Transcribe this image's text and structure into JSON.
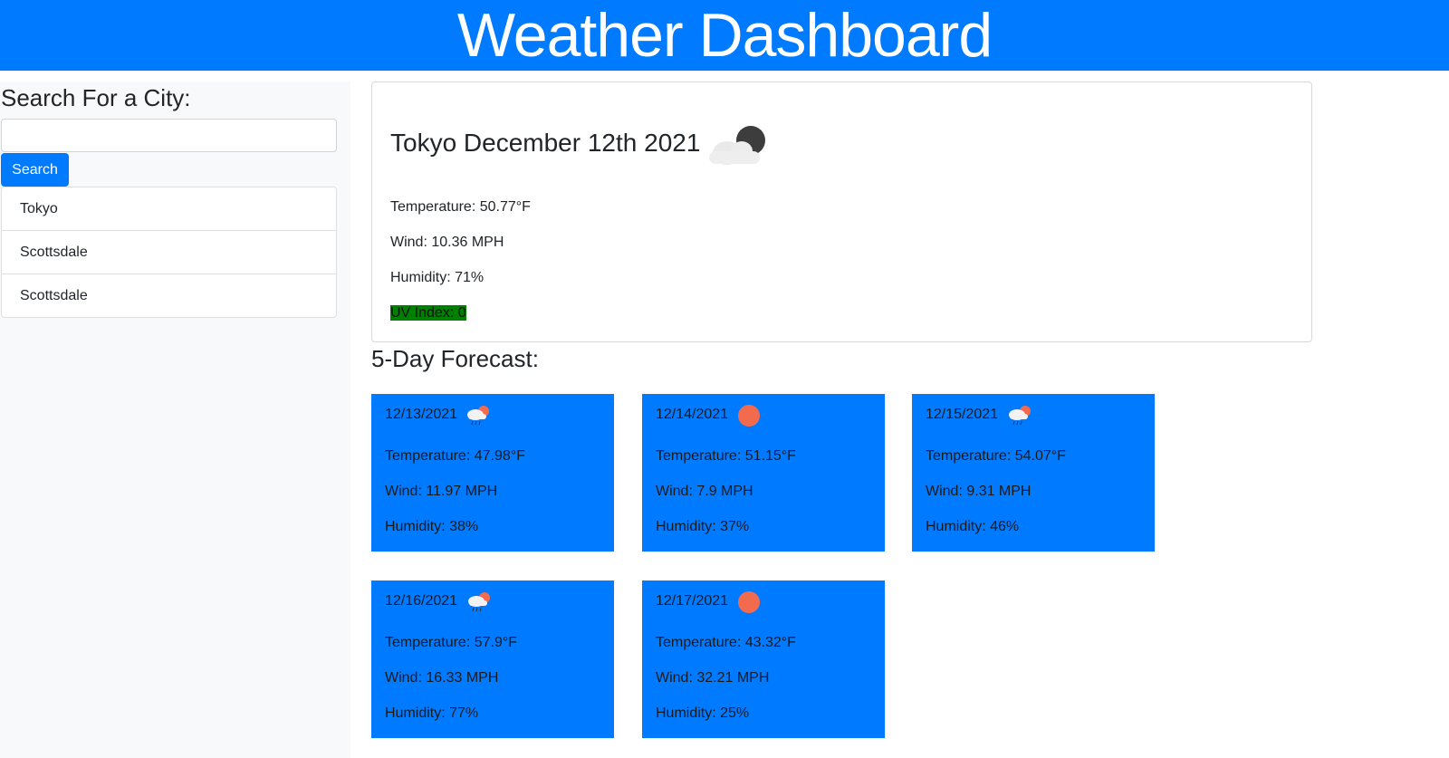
{
  "header": {
    "title": "Weather Dashboard"
  },
  "sidebar": {
    "heading": "Search For a City:",
    "search": {
      "value": "",
      "placeholder": ""
    },
    "search_button": "Search",
    "history": [
      "Tokyo",
      "Scottsdale",
      "Scottsdale"
    ]
  },
  "current": {
    "title": "Tokyo December 12th 2021",
    "icon": "night-cloud-icon",
    "temperature": "Temperature: 50.77°F",
    "wind": "Wind: 10.36 MPH",
    "humidity": "Humidity: 71%",
    "uv": "UV Index: 0"
  },
  "forecast": {
    "heading": "5-Day Forecast:",
    "days": [
      {
        "date": "12/13/2021",
        "icon": "rain-sun-icon",
        "temperature": "Temperature: 47.98°F",
        "wind": "Wind: 11.97 MPH",
        "humidity": "Humidity: 38%"
      },
      {
        "date": "12/14/2021",
        "icon": "sun-icon",
        "temperature": "Temperature: 51.15°F",
        "wind": "Wind: 7.9 MPH",
        "humidity": "Humidity: 37%"
      },
      {
        "date": "12/15/2021",
        "icon": "rain-sun-icon",
        "temperature": "Temperature: 54.07°F",
        "wind": "Wind: 9.31 MPH",
        "humidity": "Humidity: 46%"
      },
      {
        "date": "12/16/2021",
        "icon": "rain-sun-icon",
        "temperature": "Temperature: 57.9°F",
        "wind": "Wind: 16.33 MPH",
        "humidity": "Humidity: 77%"
      },
      {
        "date": "12/17/2021",
        "icon": "sun-icon",
        "temperature": "Temperature: 43.32°F",
        "wind": "Wind: 32.21 MPH",
        "humidity": "Humidity: 25%"
      }
    ]
  },
  "colors": {
    "primary": "#007bff",
    "uv_good": "#008000",
    "sun": "#f26b4f"
  }
}
